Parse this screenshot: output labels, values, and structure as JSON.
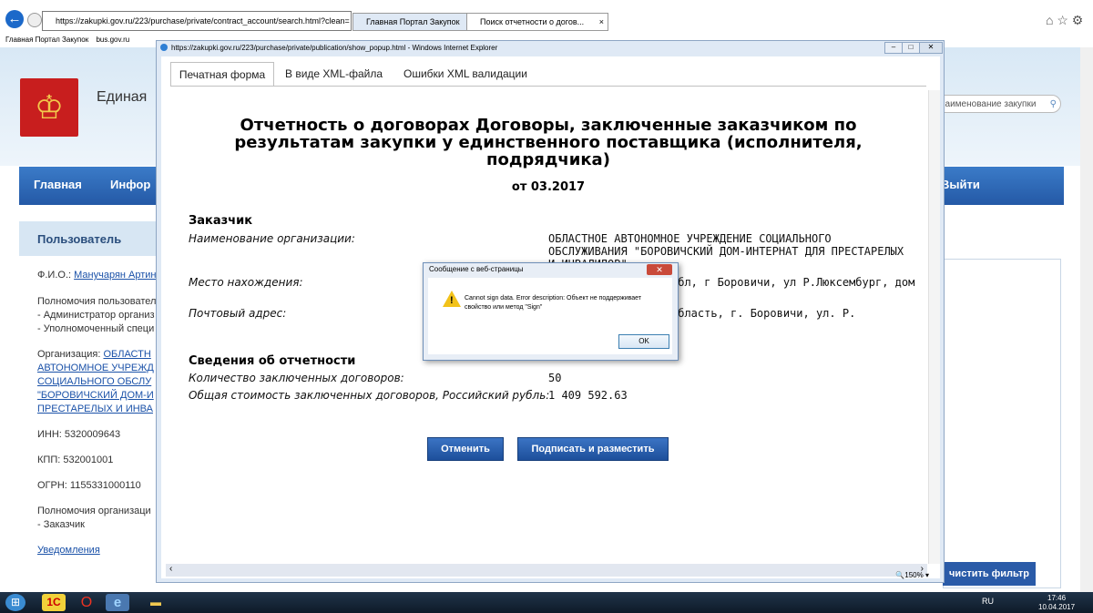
{
  "browser": {
    "address": "https://zakupki.gov.ru/223/purchase/private/contract_account/search.html?clean=",
    "tabs": [
      {
        "label": "Главная Портал Закупок"
      },
      {
        "label": "Поиск отчетности о догов..."
      }
    ],
    "favorites": [
      "Главная Портал Закупок",
      "bus.gov.ru"
    ]
  },
  "site": {
    "title": "Единая",
    "search_placeholder": "наименование закупки",
    "nav": [
      "Главная",
      "Инфор",
      "Выйти"
    ],
    "user_panel": "Пользователь",
    "fio_label": "Ф.И.О.:",
    "fio_value": "Манучарян Артин",
    "powers_label": "Полномочия пользовател",
    "powers": [
      "- Администратор организ",
      "- Уполномоченный специ"
    ],
    "org_label": "Организация:",
    "org_lines": [
      "ОБЛАСТН",
      "АВТОНОМНОЕ УЧРЕЖД",
      "СОЦИАЛЬНОГО ОБСЛУ",
      "\"БОРОВИЧСКИЙ ДОМ-И",
      "ПРЕСТАРЕЛЫХ И ИНВА"
    ],
    "inn": "ИНН: 5320009643",
    "kpp": "КПП: 532001001",
    "ogrn": "ОГРН: 1155331000110",
    "org_powers_label": "Полномочия организаци",
    "org_powers": "- Заказчик",
    "notifications": "Уведомления",
    "clear_filter": "чистить фильтр"
  },
  "popup": {
    "title": "https://zakupki.gov.ru/223/purchase/private/publication/show_popup.html - Windows Internet Explorer",
    "tabs": [
      "Печатная форма",
      "В виде XML-файла",
      "Ошибки XML валидации"
    ],
    "report_title": "Отчетность о договорах Договоры, заключенные заказчиком по результатам закупки у единственного поставщика (исполнителя, подрядчика)",
    "report_date": "от 03.2017",
    "customer_section": "Заказчик",
    "org_name_label": "Наименование организации:",
    "org_name_value": "ОБЛАСТНОЕ АВТОНОМНОЕ УЧРЕЖДЕНИЕ СОЦИАЛЬНОГО ОБСЛУЖИВАНИЯ \"БОРОВИЧСКИЙ ДОМ-ИНТЕРНАТ ДЛЯ ПРЕСТАРЕЛЫХ И ИНВАЛИДОВ\"",
    "location_label": "Место нахождения:",
    "location_value": "обл, г Боровичи, ул Р.Люксембург, дом",
    "postal_label": "Почтовый адрес:",
    "postal_value": "область, г. Боровичи, ул. Р.",
    "report_section": "Сведения об отчетности",
    "count_label": "Количество заключенных договоров:",
    "count_value": "50",
    "total_label": "Общая стоимость заключенных договоров, Российский рубль:",
    "total_value": "1 409 592.63",
    "cancel_button": "Отменить",
    "sign_button": "Подписать и разместить",
    "zoom": "150%"
  },
  "dialog": {
    "title": "Сообщение с веб-страницы",
    "message": "Cannot sign data. Error description: Объект не поддерживает свойство или метод \"Sign\"",
    "ok": "OK"
  },
  "taskbar": {
    "lang": "RU",
    "time": "17:46",
    "date": "10.04.2017"
  }
}
